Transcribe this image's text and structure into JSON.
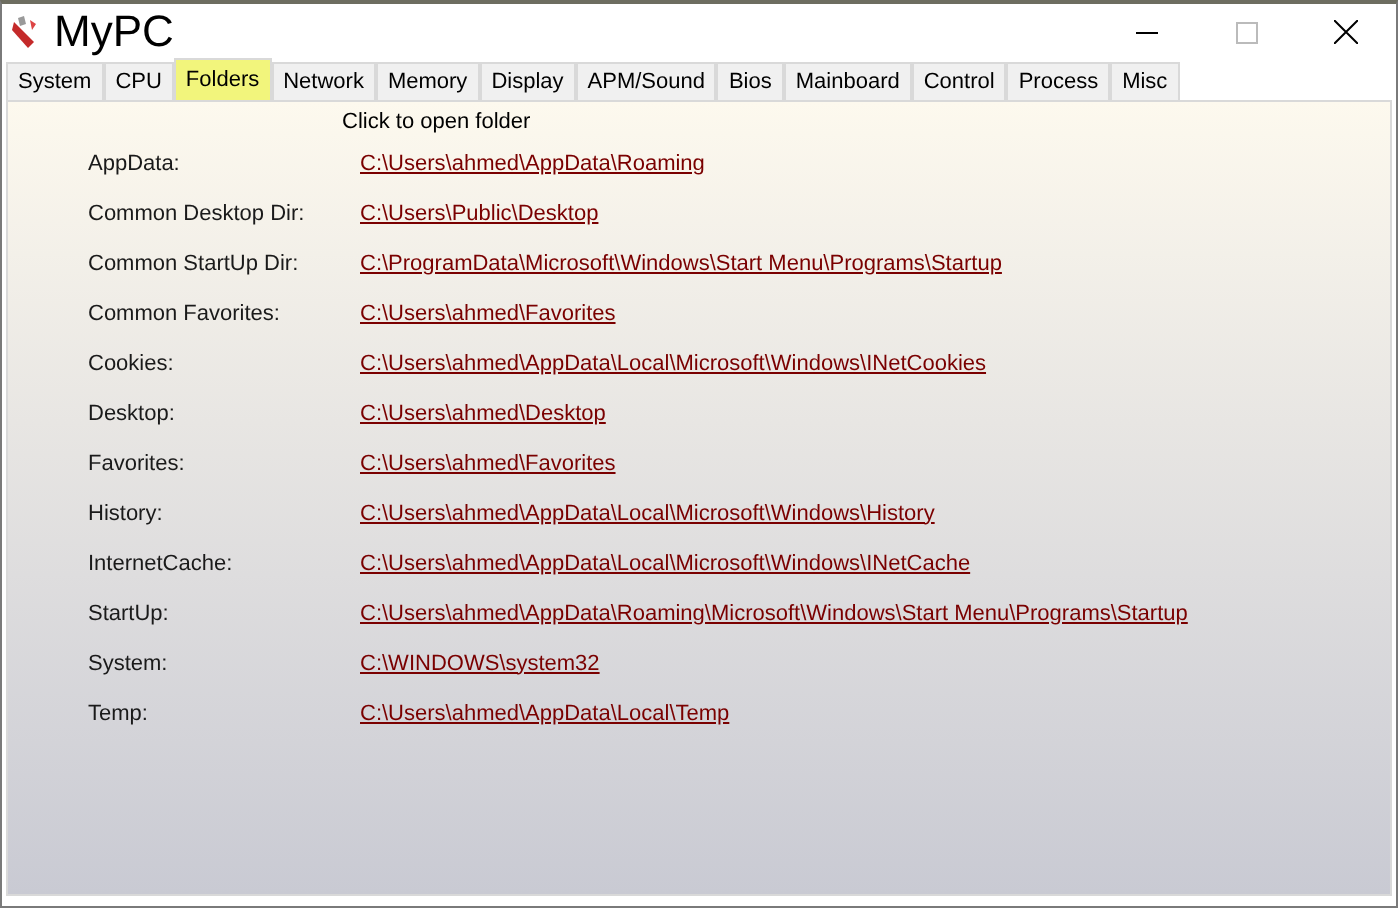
{
  "window": {
    "title": "MyPC"
  },
  "tabs": [
    {
      "label": "System",
      "selected": false
    },
    {
      "label": "CPU",
      "selected": false
    },
    {
      "label": "Folders",
      "selected": true
    },
    {
      "label": "Network",
      "selected": false
    },
    {
      "label": "Memory",
      "selected": false
    },
    {
      "label": "Display",
      "selected": false
    },
    {
      "label": "APM/Sound",
      "selected": false
    },
    {
      "label": "Bios",
      "selected": false
    },
    {
      "label": "Mainboard",
      "selected": false
    },
    {
      "label": "Control",
      "selected": false
    },
    {
      "label": "Process",
      "selected": false
    },
    {
      "label": "Misc",
      "selected": false
    }
  ],
  "hint": "Click to open folder",
  "folders": [
    {
      "label": "AppData:",
      "path": "C:\\Users\\ahmed\\AppData\\Roaming"
    },
    {
      "label": "Common Desktop Dir:",
      "path": "C:\\Users\\Public\\Desktop"
    },
    {
      "label": "Common StartUp Dir:",
      "path": "C:\\ProgramData\\Microsoft\\Windows\\Start Menu\\Programs\\Startup"
    },
    {
      "label": "Common Favorites:",
      "path": "C:\\Users\\ahmed\\Favorites"
    },
    {
      "label": "Cookies:",
      "path": "C:\\Users\\ahmed\\AppData\\Local\\Microsoft\\Windows\\INetCookies"
    },
    {
      "label": "Desktop:",
      "path": "C:\\Users\\ahmed\\Desktop"
    },
    {
      "label": "Favorites:",
      "path": "C:\\Users\\ahmed\\Favorites"
    },
    {
      "label": "History:",
      "path": "C:\\Users\\ahmed\\AppData\\Local\\Microsoft\\Windows\\History"
    },
    {
      "label": "InternetCache:",
      "path": "C:\\Users\\ahmed\\AppData\\Local\\Microsoft\\Windows\\INetCache"
    },
    {
      "label": "StartUp:",
      "path": "C:\\Users\\ahmed\\AppData\\Roaming\\Microsoft\\Windows\\Start Menu\\Programs\\Startup"
    },
    {
      "label": "System:",
      "path": "C:\\WINDOWS\\system32"
    },
    {
      "label": "Temp:",
      "path": "C:\\Users\\ahmed\\AppData\\Local\\Temp"
    }
  ]
}
